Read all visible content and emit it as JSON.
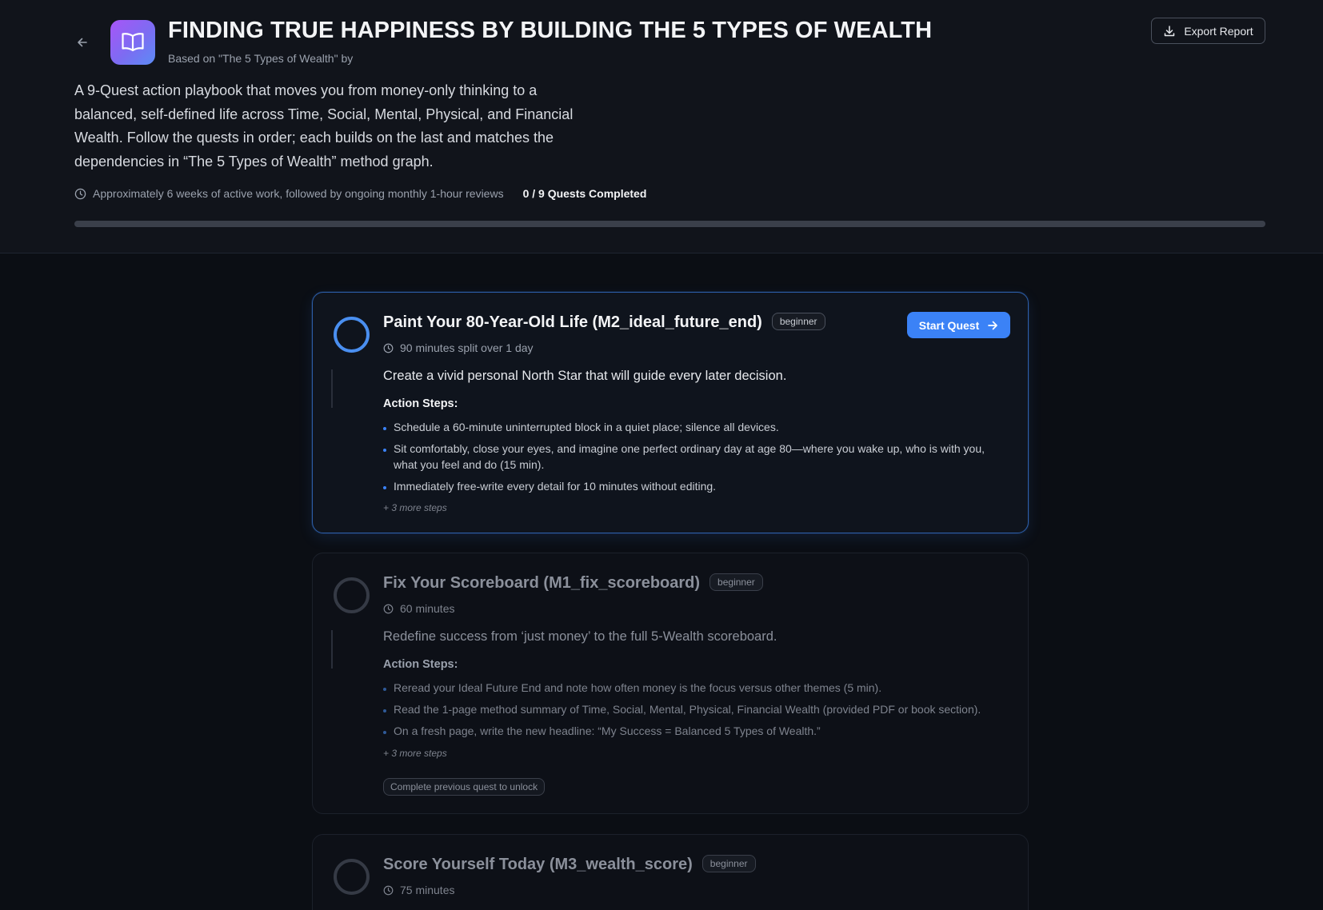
{
  "header": {
    "title": "FINDING TRUE HAPPINESS BY BUILDING THE 5 TYPES OF WEALTH",
    "subtitle": "Based on \"The 5 Types of Wealth\" by",
    "export_label": "Export Report",
    "description": "A 9-Quest action playbook that moves you from money-only thinking to a balanced, self-defined life across Time, Social, Mental, Physical, and Financial Wealth. Follow the quests in order; each builds on the last and matches the dependencies in “The 5 Types of Wealth” method graph.",
    "duration": "Approximately 6 weeks of active work, followed by ongoing monthly 1-hour reviews",
    "completed_count": "0 / 9 Quests Completed",
    "progress": 0
  },
  "colors": {
    "accent": "#3b82f6",
    "background": "#0b0e14",
    "header_background": "#11141b"
  },
  "icons": {
    "back": "arrow-left-icon",
    "app": "open-book-icon",
    "export": "download-icon",
    "clock": "clock-icon",
    "start": "arrow-right-icon"
  },
  "quests": [
    {
      "title": "Paint Your 80-Year-Old Life (M2_ideal_future_end)",
      "level": "beginner",
      "duration": "90 minutes split over 1 day",
      "goal": "Create a vivid personal North Star that will guide every later decision.",
      "steps_heading": "Action Steps:",
      "steps": [
        "Schedule a 60-minute uninterrupted block in a quiet place; silence all devices.",
        "Sit comfortably, close your eyes, and imagine one perfect ordinary day at age 80—where you wake up, who is with you, what you feel and do (15 min).",
        "Immediately free-write every detail for 10 minutes without editing."
      ],
      "more_steps": "+ 3 more steps",
      "action_label": "Start Quest"
    },
    {
      "title": "Fix Your Scoreboard (M1_fix_scoreboard)",
      "level": "beginner",
      "duration": "60 minutes",
      "goal": "Redefine success from ‘just money’ to the full 5-Wealth scoreboard.",
      "steps_heading": "Action Steps:",
      "steps": [
        "Reread your Ideal Future End and note how often money is the focus versus other themes (5 min).",
        "Read the 1-page method summary of Time, Social, Mental, Physical, Financial Wealth (provided PDF or book section).",
        "On a fresh page, write the new headline: “My Success = Balanced 5 Types of Wealth.”"
      ],
      "more_steps": "+ 3 more steps",
      "lock_note": "Complete previous quest to unlock"
    },
    {
      "title": "Score Yourself Today (M3_wealth_score)",
      "level": "beginner",
      "duration": "75 minutes"
    }
  ]
}
